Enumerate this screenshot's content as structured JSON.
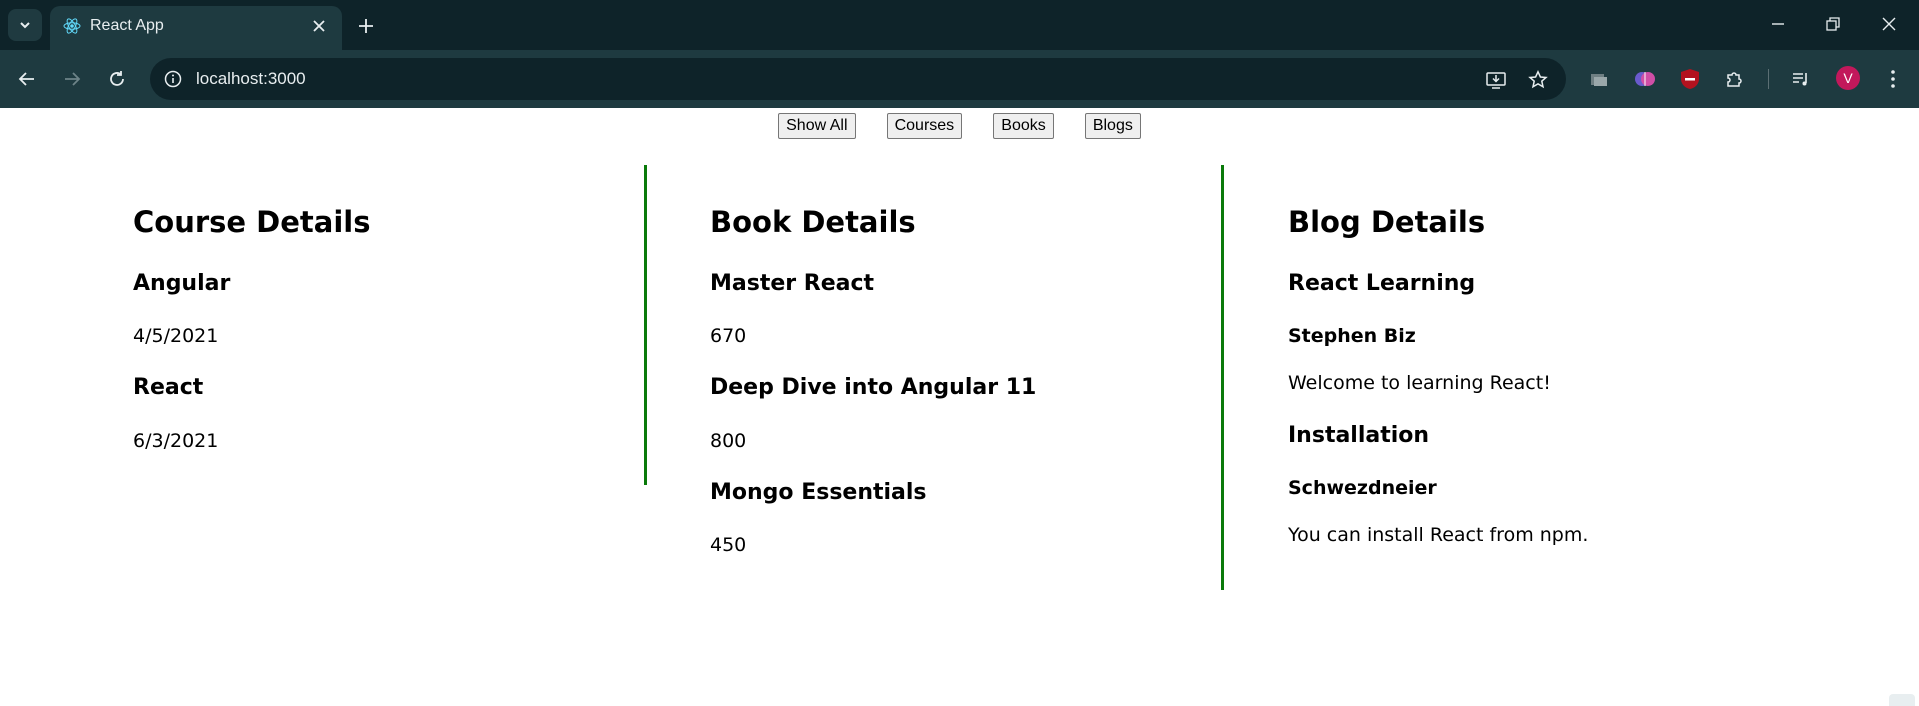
{
  "browser": {
    "tab_title": "React App",
    "url": "localhost:3000",
    "avatar_letter": "V"
  },
  "filters": {
    "show_all": "Show All",
    "courses": "Courses",
    "books": "Books",
    "blogs": "Blogs"
  },
  "courses": {
    "heading": "Course Details",
    "items": [
      {
        "name": "Angular",
        "date": "4/5/2021"
      },
      {
        "name": "React",
        "date": "6/3/2021"
      }
    ]
  },
  "books": {
    "heading": "Book Details",
    "items": [
      {
        "name": "Master React",
        "price": "670"
      },
      {
        "name": "Deep Dive into Angular 11",
        "price": "800"
      },
      {
        "name": "Mongo Essentials",
        "price": "450"
      }
    ]
  },
  "blogs": {
    "heading": "Blog Details",
    "items": [
      {
        "title": "React Learning",
        "author": "Stephen Biz",
        "content": "Welcome to learning React!"
      },
      {
        "title": "Installation",
        "author": "Schwezdneier",
        "content": "You can install React from npm."
      }
    ]
  },
  "colors": {
    "divider": "#0a7a0a",
    "chrome_bg": "#0e2329",
    "chrome_toolbar": "#1e3a40"
  }
}
